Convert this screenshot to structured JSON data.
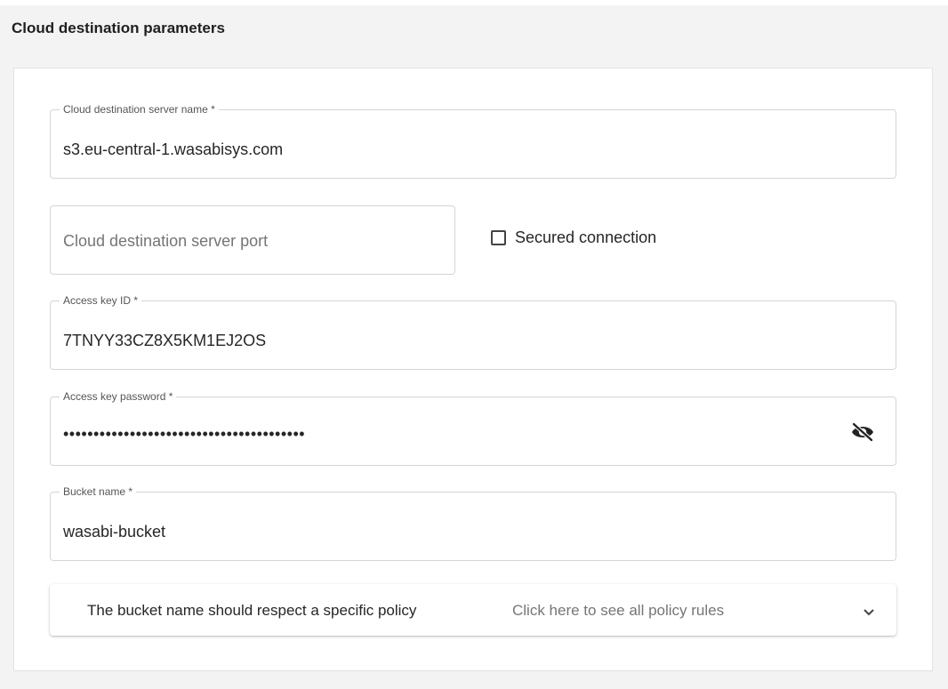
{
  "panel": {
    "title": "Cloud destination parameters"
  },
  "fields": {
    "server_name": {
      "label": "Cloud destination server name *",
      "value": "s3.eu-central-1.wasabisys.com"
    },
    "server_port": {
      "placeholder": "Cloud destination server port"
    },
    "secured_connection": {
      "label": "Secured connection",
      "checked": false
    },
    "access_key_id": {
      "label": "Access key ID *",
      "value": "7TNYY33CZ8X5KM1EJ2OS"
    },
    "access_key_password": {
      "label": "Access key password *",
      "masked_value": "••••••••••••••••••••••••••••••••••••••••",
      "icon": "eye-off-icon"
    },
    "bucket_name": {
      "label": "Bucket name *",
      "value": "wasabi-bucket"
    }
  },
  "policy": {
    "title": "The bucket name should respect a specific policy",
    "hint": "Click here to see all policy rules",
    "icon": "chevron-down-icon"
  }
}
